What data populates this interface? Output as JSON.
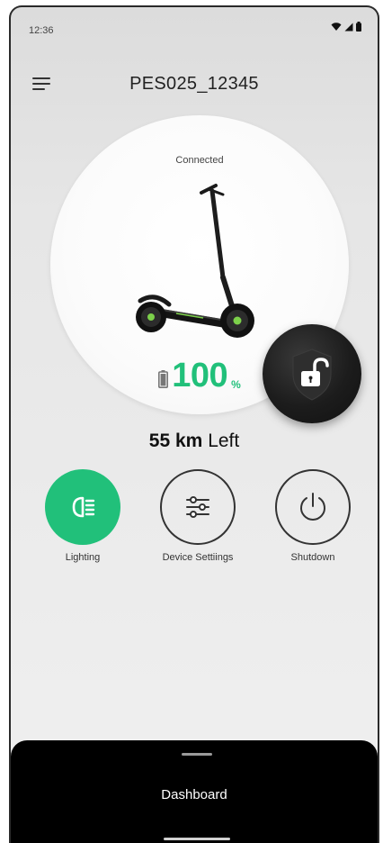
{
  "status_bar": {
    "time": "12:36",
    "icons": [
      "wifi-icon",
      "signal-icon",
      "battery-icon"
    ]
  },
  "header": {
    "title": "PES025_12345",
    "menu_icon": "hamburger-menu-icon"
  },
  "dial": {
    "connection_status": "Connected",
    "battery_value": "100",
    "battery_unit": "%",
    "battery_icon": "battery-icon",
    "lock_icon": "unlocked-padlock-icon"
  },
  "range": {
    "value": "55",
    "unit": "km",
    "suffix": "Left"
  },
  "actions": [
    {
      "label": "Lighting",
      "icon": "headlight-icon",
      "active": true
    },
    {
      "label": "Device Settiings",
      "icon": "sliders-icon",
      "active": false
    },
    {
      "label": "Shutdown",
      "icon": "power-icon",
      "active": false
    }
  ],
  "bottom_sheet": {
    "title": "Dashboard"
  },
  "colors": {
    "accent": "#21c07a",
    "dark": "#111111",
    "sheet": "#000000"
  }
}
